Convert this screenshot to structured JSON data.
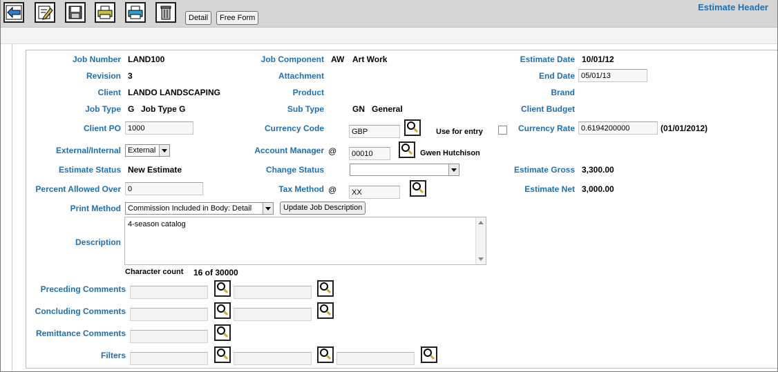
{
  "header": {
    "title": "Estimate Header",
    "detail_label": "Detail",
    "free_form_label": "Free Form"
  },
  "toolbar_icons": [
    "back-icon",
    "edit-icon",
    "save-icon",
    "print-icon",
    "print-alt-icon",
    "delete-icon"
  ],
  "fields": {
    "job_number": {
      "label": "Job Number",
      "value": "LAND100"
    },
    "revision": {
      "label": "Revision",
      "value": "3"
    },
    "client": {
      "label": "Client",
      "value": "LANDO LANDSCAPING"
    },
    "job_type": {
      "label": "Job Type",
      "code": "G",
      "value": "Job Type G"
    },
    "client_po": {
      "label": "Client PO",
      "value": "1000"
    },
    "external_internal": {
      "label": "External/Internal",
      "value": "External"
    },
    "estimate_status": {
      "label": "Estimate Status",
      "value": "New Estimate"
    },
    "percent_allowed_over": {
      "label": "Percent Allowed Over",
      "value": "0"
    },
    "print_method": {
      "label": "Print Method",
      "value": "Commission Included in Body: Detail"
    },
    "update_job_description": "Update Job Description",
    "description": {
      "label": "Description",
      "value": "4-season catalog"
    },
    "character_count": {
      "label": "Character count",
      "value": "16 of 30000"
    },
    "job_component": {
      "label": "Job Component",
      "code": "AW",
      "value": "Art Work"
    },
    "attachment": {
      "label": "Attachment"
    },
    "product": {
      "label": "Product"
    },
    "sub_type": {
      "label": "Sub Type",
      "code": "GN",
      "value": "General"
    },
    "currency_code": {
      "label": "Currency Code",
      "value": "GBP"
    },
    "use_for_entry": {
      "label": "Use for entry",
      "checked": false
    },
    "account_manager": {
      "label": "Account Manager",
      "at": "@",
      "code": "00010",
      "name": "Gwen Hutchison"
    },
    "change_status": {
      "label": "Change Status",
      "value": ""
    },
    "tax_method": {
      "label": "Tax Method",
      "at": "@",
      "value": "XX"
    },
    "estimate_date": {
      "label": "Estimate Date",
      "value": "10/01/12"
    },
    "end_date": {
      "label": "End Date",
      "value": "05/01/13"
    },
    "brand": {
      "label": "Brand"
    },
    "client_budget": {
      "label": "Client Budget"
    },
    "currency_rate": {
      "label": "Currency Rate",
      "value": "0.6194200000",
      "date": "(01/01/2012)"
    },
    "estimate_gross": {
      "label": "Estimate Gross",
      "value": "3,300.00"
    },
    "estimate_net": {
      "label": "Estimate Net",
      "value": "3,000.00"
    }
  },
  "comments": {
    "preceding": {
      "label": "Preceding Comments"
    },
    "concluding": {
      "label": "Concluding Comments"
    },
    "remittance": {
      "label": "Remittance Comments"
    },
    "filters": {
      "label": "Filters"
    }
  },
  "colors": {
    "label_blue": "#1f6fb2",
    "toolbar_gray": "#d6d6d6"
  }
}
